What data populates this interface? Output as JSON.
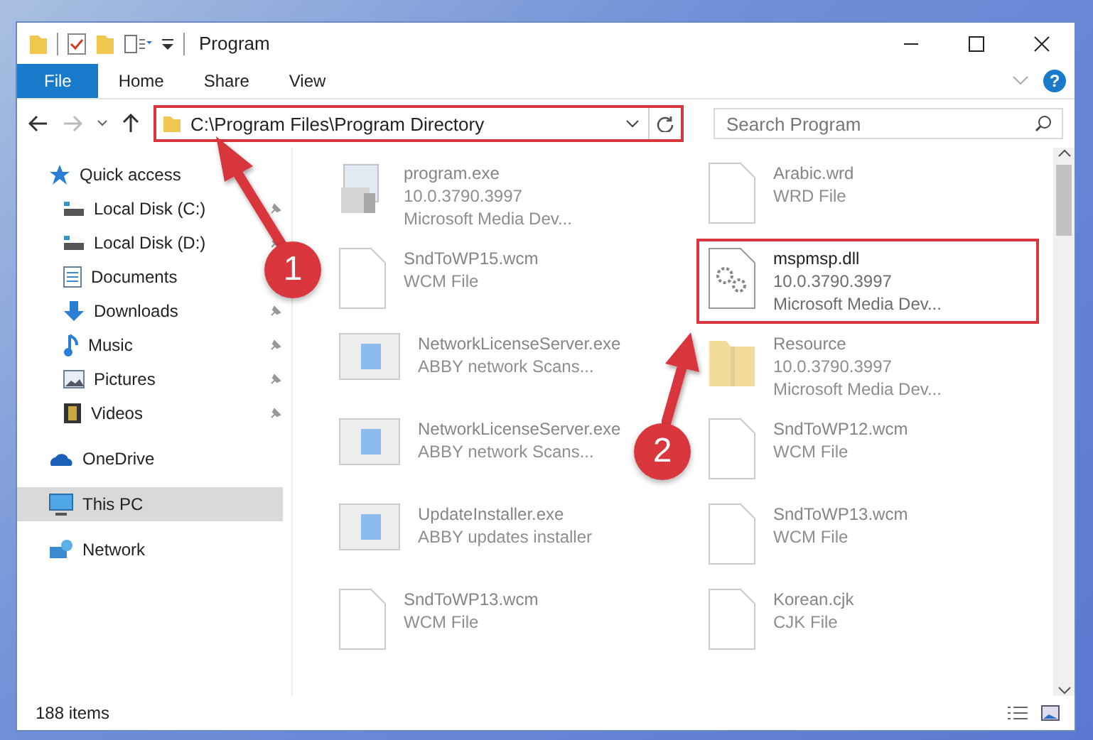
{
  "window": {
    "title": "Program"
  },
  "ribbon": {
    "tabs": [
      {
        "label": "File",
        "selected": true
      },
      {
        "label": "Home",
        "selected": false
      },
      {
        "label": "Share",
        "selected": false
      },
      {
        "label": "View",
        "selected": false
      }
    ],
    "help": "?"
  },
  "address": {
    "path": "C:\\Program Files\\Program Directory",
    "highlighted": true
  },
  "search": {
    "placeholder": "Search Program"
  },
  "sidebar": {
    "items": [
      {
        "label": "Quick access",
        "kind": "star",
        "pinned": false,
        "selected": false,
        "children": [
          {
            "label": "Local Disk (C:)",
            "kind": "disk",
            "pinned": true,
            "selected": false
          },
          {
            "label": "Local Disk (D:)",
            "kind": "disk",
            "pinned": true,
            "selected": false
          },
          {
            "label": "Documents",
            "kind": "documents",
            "selected": false
          },
          {
            "label": "Downloads",
            "kind": "downloads",
            "pinned": true,
            "selected": false
          },
          {
            "label": "Music",
            "kind": "music",
            "pinned": true,
            "selected": false
          },
          {
            "label": "Pictures",
            "kind": "pictures",
            "pinned": true,
            "selected": false
          },
          {
            "label": "Videos",
            "kind": "videos",
            "pinned": true,
            "selected": false
          }
        ]
      },
      {
        "label": "OneDrive",
        "kind": "cloud",
        "pinned": false,
        "selected": false
      },
      {
        "label": "This PC",
        "kind": "computer",
        "pinned": false,
        "selected": true
      },
      {
        "label": "Network",
        "kind": "network",
        "pinned": false,
        "selected": false
      }
    ]
  },
  "files": [
    {
      "name": "program.exe",
      "lines": [
        "10.0.3790.3997",
        "Microsoft Media Dev..."
      ],
      "kind": "installer",
      "highlighted": false
    },
    {
      "name": "Arabic.wrd",
      "lines": [
        "WRD File"
      ],
      "kind": "document",
      "highlighted": false
    },
    {
      "name": "SndToWP15.wcm",
      "lines": [
        "WCM File"
      ],
      "kind": "document",
      "highlighted": false
    },
    {
      "name": "mspmsp.dll",
      "lines": [
        "10.0.3790.3997",
        "Microsoft Media Dev..."
      ],
      "kind": "dll",
      "highlighted": true
    },
    {
      "name": "NetworkLicenseServer.exe",
      "lines": [
        "ABBY network Scans..."
      ],
      "kind": "app",
      "highlighted": false
    },
    {
      "name": "Resource",
      "lines": [
        "10.0.3790.3997",
        "Microsoft Media Dev..."
      ],
      "kind": "folder",
      "highlighted": false
    },
    {
      "name": "NetworkLicenseServer.exe",
      "lines": [
        "ABBY network Scans..."
      ],
      "kind": "app",
      "highlighted": false
    },
    {
      "name": "SndToWP12.wcm",
      "lines": [
        "WCM File"
      ],
      "kind": "document",
      "highlighted": false
    },
    {
      "name": "UpdateInstaller.exe",
      "lines": [
        "ABBY updates installer"
      ],
      "kind": "app",
      "highlighted": false
    },
    {
      "name": "SndToWP13.wcm",
      "lines": [
        "WCM File"
      ],
      "kind": "document",
      "highlighted": false
    },
    {
      "name": "SndToWP13.wcm",
      "lines": [
        "WCM File"
      ],
      "kind": "document",
      "highlighted": false
    },
    {
      "name": "Korean.cjk",
      "lines": [
        "CJK File"
      ],
      "kind": "document",
      "highlighted": false
    }
  ],
  "status_bar": {
    "item_count": "188 items"
  },
  "annotations": [
    {
      "number": "1"
    },
    {
      "number": "2"
    }
  ]
}
